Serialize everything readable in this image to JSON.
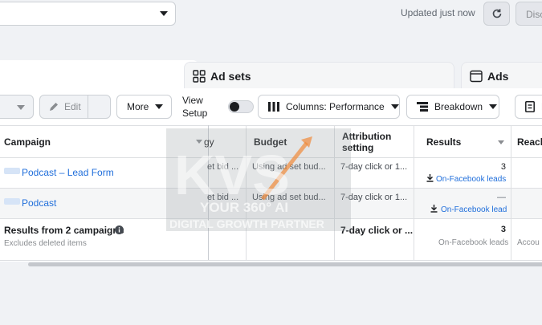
{
  "topbar": {
    "account_select_value": "",
    "updated_text": "Updated just now",
    "discard_label": "Disc"
  },
  "tabs": [
    {
      "label": "Ad sets",
      "icon": "grid-icon"
    },
    {
      "label": "Ads",
      "icon": "ad-icon"
    }
  ],
  "toolbar": {
    "edit_label": "Edit",
    "more_label": "More",
    "view_setup_label": "View Setup",
    "columns_label": "Columns: Performance",
    "breakdown_label": "Breakdown",
    "reports_label": "R"
  },
  "table": {
    "headers": {
      "campaign": "Campaign",
      "strategy": "gy",
      "budget": "Budget",
      "attribution": "Attribution setting",
      "results": "Results",
      "reach": "Reach"
    },
    "rows": [
      {
        "campaign": "Podcast – Lead Form",
        "strategy": "et bid ...",
        "budget": "Using ad set bud...",
        "attribution": "7-day click or 1...",
        "results_value": "3",
        "results_type": "On-Facebook leads"
      },
      {
        "campaign": "Podcast",
        "strategy": "et bid ...",
        "budget": "Using ad set bud...",
        "attribution": "7-day click or 1...",
        "results_value": "—",
        "results_type": "On-Facebook lead"
      }
    ],
    "summary": {
      "title": "Results from 2 campaigns",
      "subtitle": "Excludes deleted items",
      "attribution": "7-day click or ...",
      "results_value": "3",
      "results_type": "On-Facebook leads",
      "reach": "Accou"
    }
  },
  "watermark": {
    "logo_text": "KVS",
    "tagline_1": "YOUR 360° AI",
    "tagline_2": "DIGITAL GROWTH PARTNER"
  },
  "colors": {
    "link": "#216fdb",
    "accent_orange": "#f08a3a"
  }
}
